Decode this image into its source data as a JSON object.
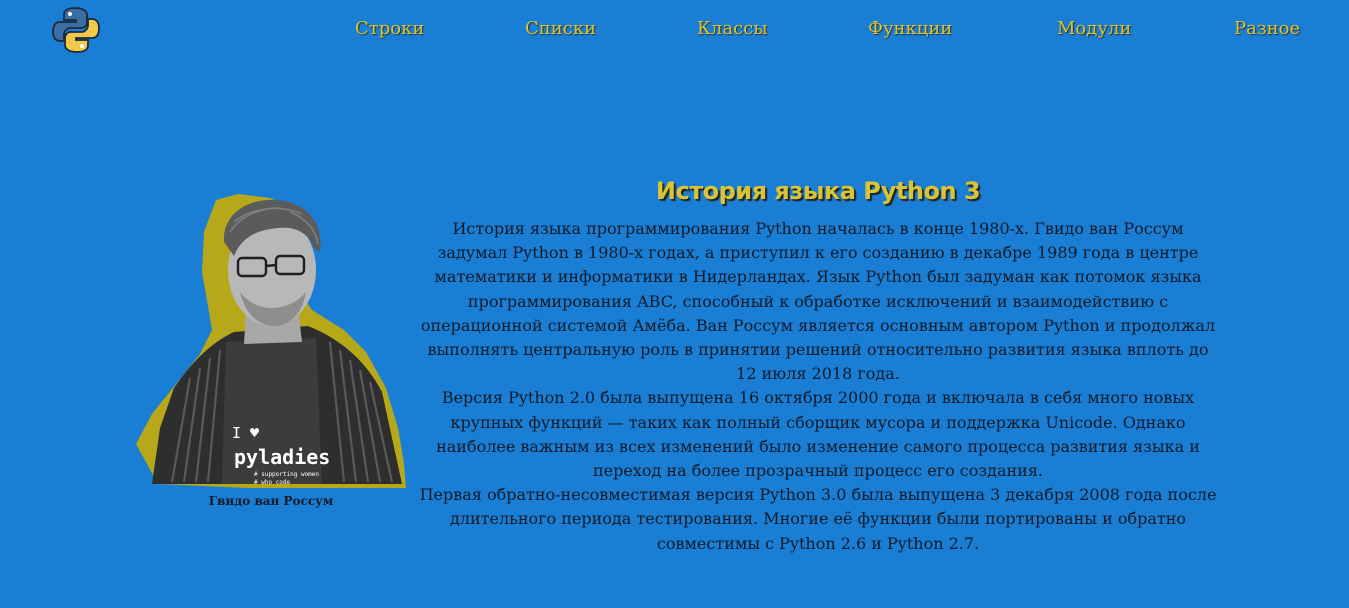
{
  "nav": {
    "items": [
      "Строки",
      "Списки",
      "Классы",
      "Функции",
      "Модули",
      "Разное"
    ]
  },
  "logo": {
    "icon": "python-logo-icon",
    "colors": [
      "#3b6fa3",
      "#f2c948"
    ]
  },
  "portrait": {
    "caption": "Гвидо ван Россум",
    "shirt_text": "I ♥ pyladies",
    "shirt_subtext": "# supporting women # who code"
  },
  "article": {
    "title": "История языка Python 3",
    "paragraphs": [
      "История языка программирования Python началась в конце 1980-х. Гвидо ван Россум задумал Python в 1980-х годах, а приступил к его созданию в декабре 1989 года в центре математики и информатики в Нидерландах. Язык Python был задуман как потомок языка программирования ABC, способный к обработке исключений и взаимодействию с операционной системой Амёба. Ван Россум является основным автором Python и продолжал выполнять центральную роль в принятии решений относительно развития языка вплоть до 12 июля 2018 года.",
      "Версия Python 2.0 была выпущена 16 октября 2000 года и включала в себя много новых крупных функций — таких как полный сборщик мусора и поддержка Unicode. Однако наиболее важным из всех изменений было изменение самого процесса развития языка и переход на более прозрачный процесс его создания.",
      "Первая обратно-несовместимая версия Python 3.0 была выпущена 3 декабря 2008 года после длительного периода тестирования. Многие её функции были портированы и обратно совместимы с Python 2.6 и Python 2.7."
    ]
  },
  "colors": {
    "background": "#1a7fd4",
    "accent": "#d9c436",
    "text": "#0f1a2a"
  }
}
